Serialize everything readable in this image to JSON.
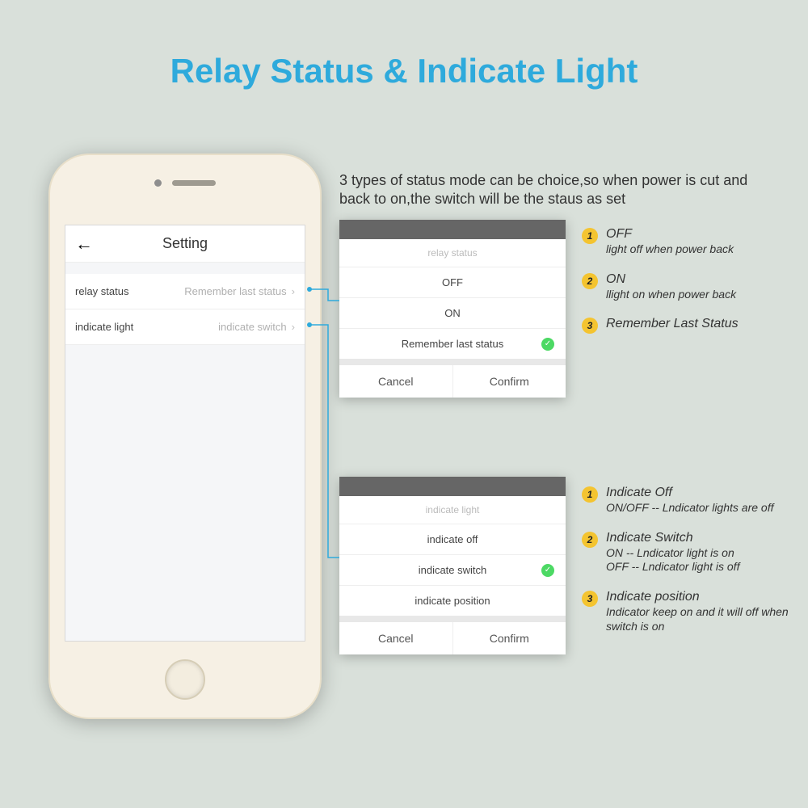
{
  "title": "Relay Status & Indicate Light",
  "intro": "3 types of status mode can be choice,so when power is cut and back to on,the switch will be the staus as set",
  "phone": {
    "nav_title": "Setting",
    "rows": [
      {
        "label": "relay status",
        "value": "Remember last status"
      },
      {
        "label": "indicate light",
        "value": "indicate switch"
      }
    ]
  },
  "panel_top": {
    "sheet_title": "relay status",
    "options": [
      "OFF",
      "ON",
      "Remember last status"
    ],
    "selected_index": 2,
    "cancel": "Cancel",
    "confirm": "Confirm"
  },
  "panel_bottom": {
    "sheet_title": "indicate light",
    "options": [
      "indicate off",
      "indicate switch",
      "indicate position"
    ],
    "selected_index": 1,
    "cancel": "Cancel",
    "confirm": "Confirm"
  },
  "annot_top": [
    {
      "num": "1",
      "title": "OFF",
      "desc": "light off when power back"
    },
    {
      "num": "2",
      "title": "ON",
      "desc": "llight on when power back"
    },
    {
      "num": "3",
      "title": "Remember Last Status",
      "desc": ""
    }
  ],
  "annot_bottom": [
    {
      "num": "1",
      "title": "Indicate Off",
      "desc": "ON/OFF -- Lndicator lights are off"
    },
    {
      "num": "2",
      "title": "Indicate Switch",
      "desc": "ON -- Lndicator light is on\nOFF -- Lndicator light is off"
    },
    {
      "num": "3",
      "title": "Indicate position",
      "desc": "Indicator keep on and it will off when switch is on"
    }
  ]
}
